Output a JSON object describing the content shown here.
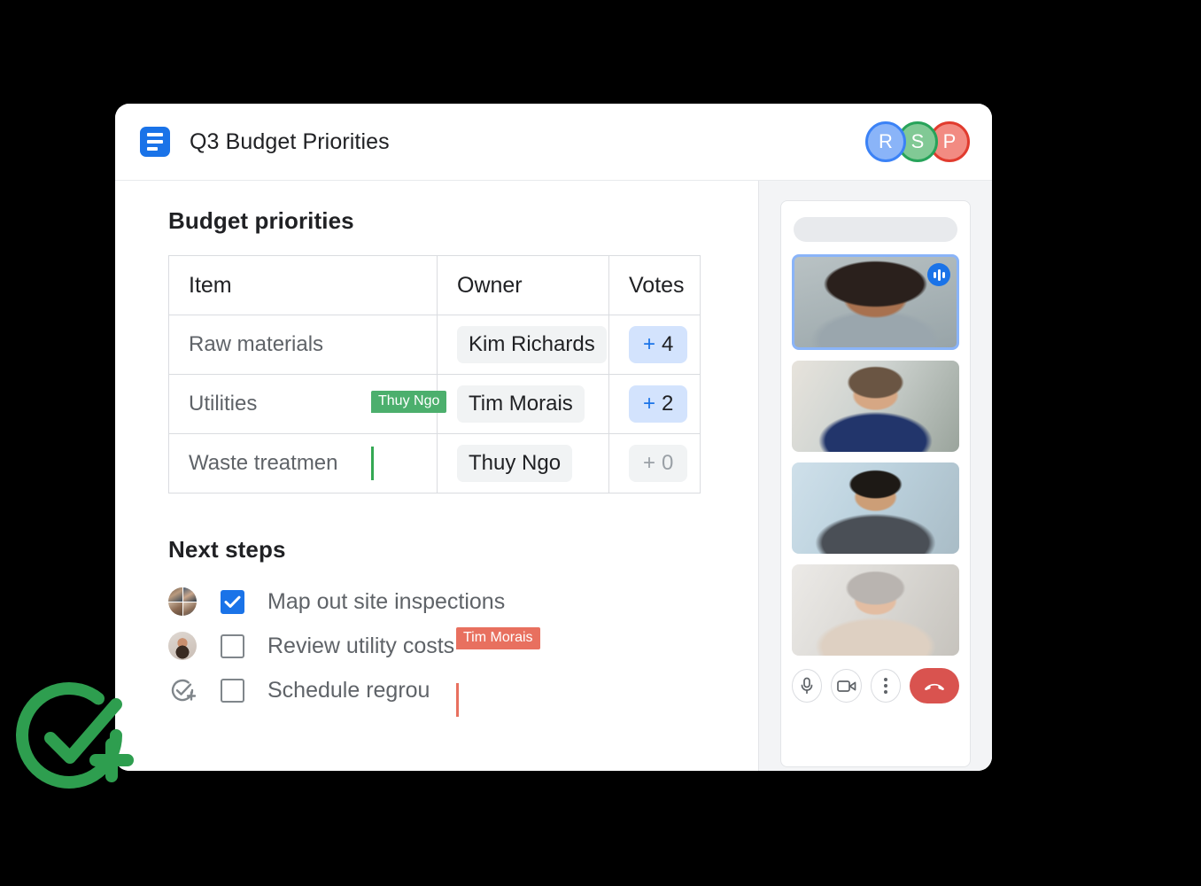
{
  "window": {
    "title": "Q3 Budget Priorities",
    "doc_icon": "document-icon"
  },
  "presence_avatars": [
    {
      "initial": "R",
      "color": "#8ab4f8",
      "ring": "#3b82f6"
    },
    {
      "initial": "S",
      "color": "#81c995",
      "ring": "#27a35a"
    },
    {
      "initial": "P",
      "color": "#f28b82",
      "ring": "#e13b2e"
    }
  ],
  "document": {
    "section_budget_title": "Budget priorities",
    "table": {
      "columns": [
        "Item",
        "Owner",
        "Votes"
      ],
      "rows": [
        {
          "item": "Raw materials",
          "owner": "Kim Richards",
          "votes_plus": "+",
          "votes": "4",
          "votes_state": "active"
        },
        {
          "item": "Utilities",
          "owner": "Tim Morais",
          "votes_plus": "+",
          "votes": "2",
          "votes_state": "active"
        },
        {
          "item": "Waste treatmen",
          "owner": "Thuy Ngo",
          "votes_plus": "+",
          "votes": "0",
          "votes_state": "zero"
        }
      ]
    },
    "section_next_title": "Next steps",
    "next_steps": [
      {
        "label": "Map out site inspections",
        "checked": true,
        "avatar": "group-of-four-faces"
      },
      {
        "label": "Review utility costs",
        "checked": false,
        "avatar": "single-face-photo"
      },
      {
        "label": "Schedule regrou",
        "checked": false,
        "avatar": "add-task-icon"
      }
    ]
  },
  "cursors": [
    {
      "name": "Thuy Ngo",
      "color": "#4caf6d",
      "caret_color": "#34a853",
      "location": "item-cell-row-3"
    },
    {
      "name": "Tim Morais",
      "color": "#e8705f",
      "caret_color": "#e8705f",
      "location": "next-step-row-3"
    }
  ],
  "video_panel": {
    "search_placeholder": "",
    "participants": [
      {
        "id": "participant-1",
        "active_speaker": true,
        "badge": "speaking-indicator-icon"
      },
      {
        "id": "participant-2",
        "active_speaker": false,
        "badge": ""
      },
      {
        "id": "participant-3",
        "active_speaker": false,
        "badge": ""
      },
      {
        "id": "participant-4",
        "active_speaker": false,
        "badge": ""
      }
    ],
    "controls": [
      {
        "name": "microphone-button",
        "icon": "microphone-icon",
        "label": ""
      },
      {
        "name": "camera-button",
        "icon": "video-camera-icon",
        "label": ""
      },
      {
        "name": "more-options-button",
        "icon": "three-dots-icon",
        "label": ""
      },
      {
        "name": "hang-up-button",
        "icon": "phone-hangup-icon",
        "label": ""
      }
    ]
  },
  "overlay": {
    "badge_icon": "check-circle-plus-icon",
    "badge_color": "#2e9e4f"
  },
  "colors": {
    "accent_blue": "#1a73e8",
    "chip_blue": "#d3e3fd",
    "chip_grey": "#f1f3f4",
    "hangup_red": "#d9534f",
    "page_bg": "#000000"
  }
}
